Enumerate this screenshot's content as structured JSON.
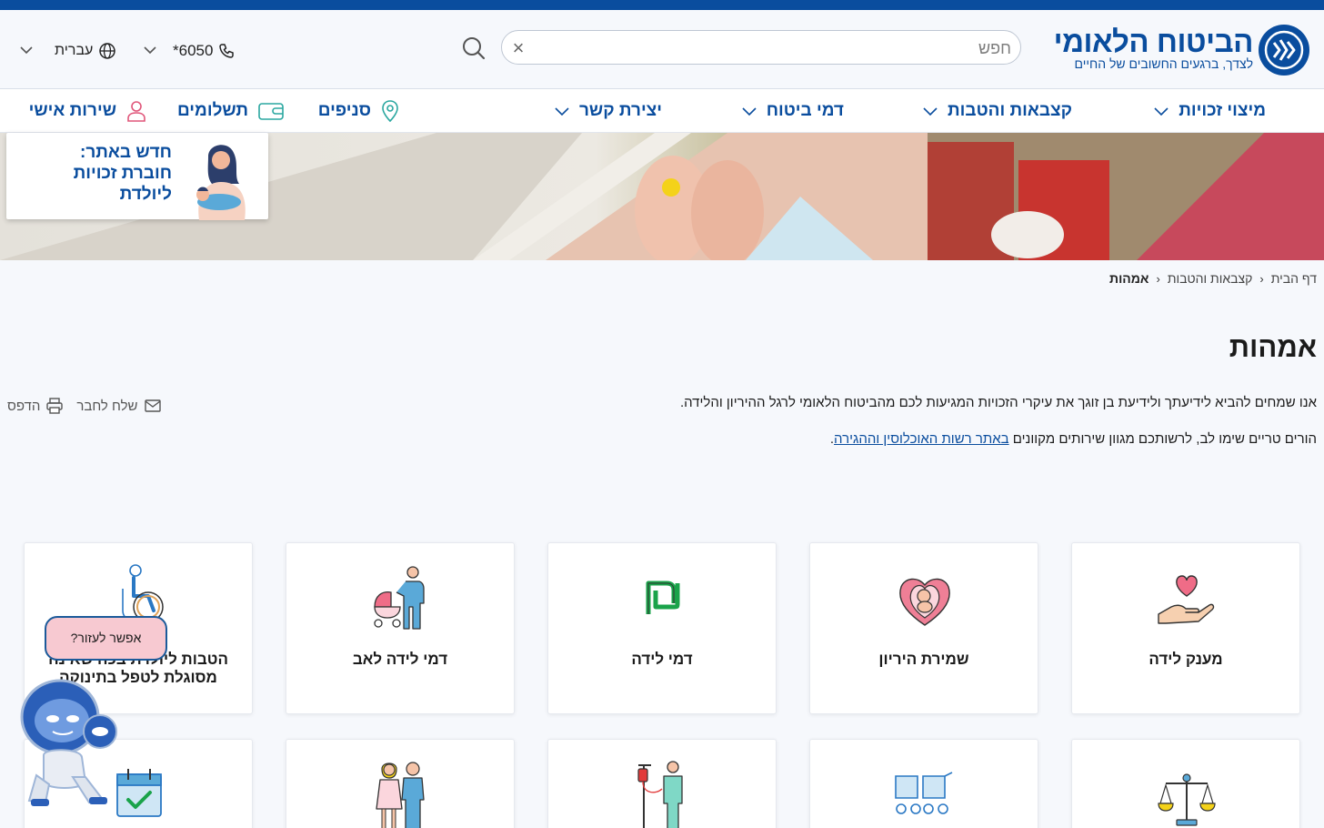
{
  "header": {
    "logo_name": "הביטוח הלאומי",
    "logo_tagline": "לצדך, ברגעים החשובים של החיים",
    "search_placeholder": "חפש",
    "phone": "*6050",
    "language": "עברית"
  },
  "nav": {
    "items": [
      {
        "label": "מיצוי זכויות",
        "has_dropdown": true
      },
      {
        "label": "קצבאות והטבות",
        "has_dropdown": true
      },
      {
        "label": "דמי ביטוח",
        "has_dropdown": true
      },
      {
        "label": "יצירת קשר",
        "has_dropdown": true
      },
      {
        "label": "סניפים",
        "icon": "map-pin-icon"
      },
      {
        "label": "תשלומים",
        "icon": "wallet-icon"
      },
      {
        "label": "שירות אישי",
        "icon": "user-icon"
      }
    ]
  },
  "promo": {
    "line1": "חדש באתר:",
    "line2": "חוברת זכויות",
    "line3": "ליולדת"
  },
  "breadcrumb": {
    "home": "דף הבית",
    "section": "קצבאות והטבות",
    "current": "אמהות"
  },
  "page": {
    "title": "אמהות",
    "intro": "אנו שמחים להביא לידיעתך ולידיעת בן זוגך את עיקרי הזכויות המגיעות לכם מהביטוח הלאומי לרגל ההיריון והלידה.",
    "intro2_prefix": "הורים טריים שימו לב, לרשותכם מגוון שירותים מקוונים ",
    "intro2_link": "באתר רשות האוכלוסין וההגירה",
    "intro2_suffix": "."
  },
  "tools": {
    "send": "שלח לחבר",
    "print": "הדפס"
  },
  "cards": [
    {
      "label": "מענק לידה",
      "icon": "heart-hand-icon"
    },
    {
      "label": "שמירת היריון",
      "icon": "pregnancy-heart-icon"
    },
    {
      "label": "דמי לידה",
      "icon": "shekel-icon"
    },
    {
      "label": "דמי לידה לאב",
      "icon": "father-stroller-icon"
    },
    {
      "label": "הטבות ליולדת בכה שאינה מסוגלת לטפל בתינוקה",
      "icon": "wheelchair-icon"
    },
    {
      "label": "",
      "icon": "scales-icon"
    },
    {
      "label": "",
      "icon": "twin-strollers-icon"
    },
    {
      "label": "",
      "icon": "hospital-iv-icon"
    },
    {
      "label": "",
      "icon": "couple-icon"
    },
    {
      "label": "",
      "icon": "calendar-check-icon"
    }
  ],
  "help": {
    "bubble": "אפשר לעזור?"
  },
  "colors": {
    "brand": "#0a4d9e",
    "background": "#f6f8fc",
    "bubble": "#f7c9d1"
  }
}
